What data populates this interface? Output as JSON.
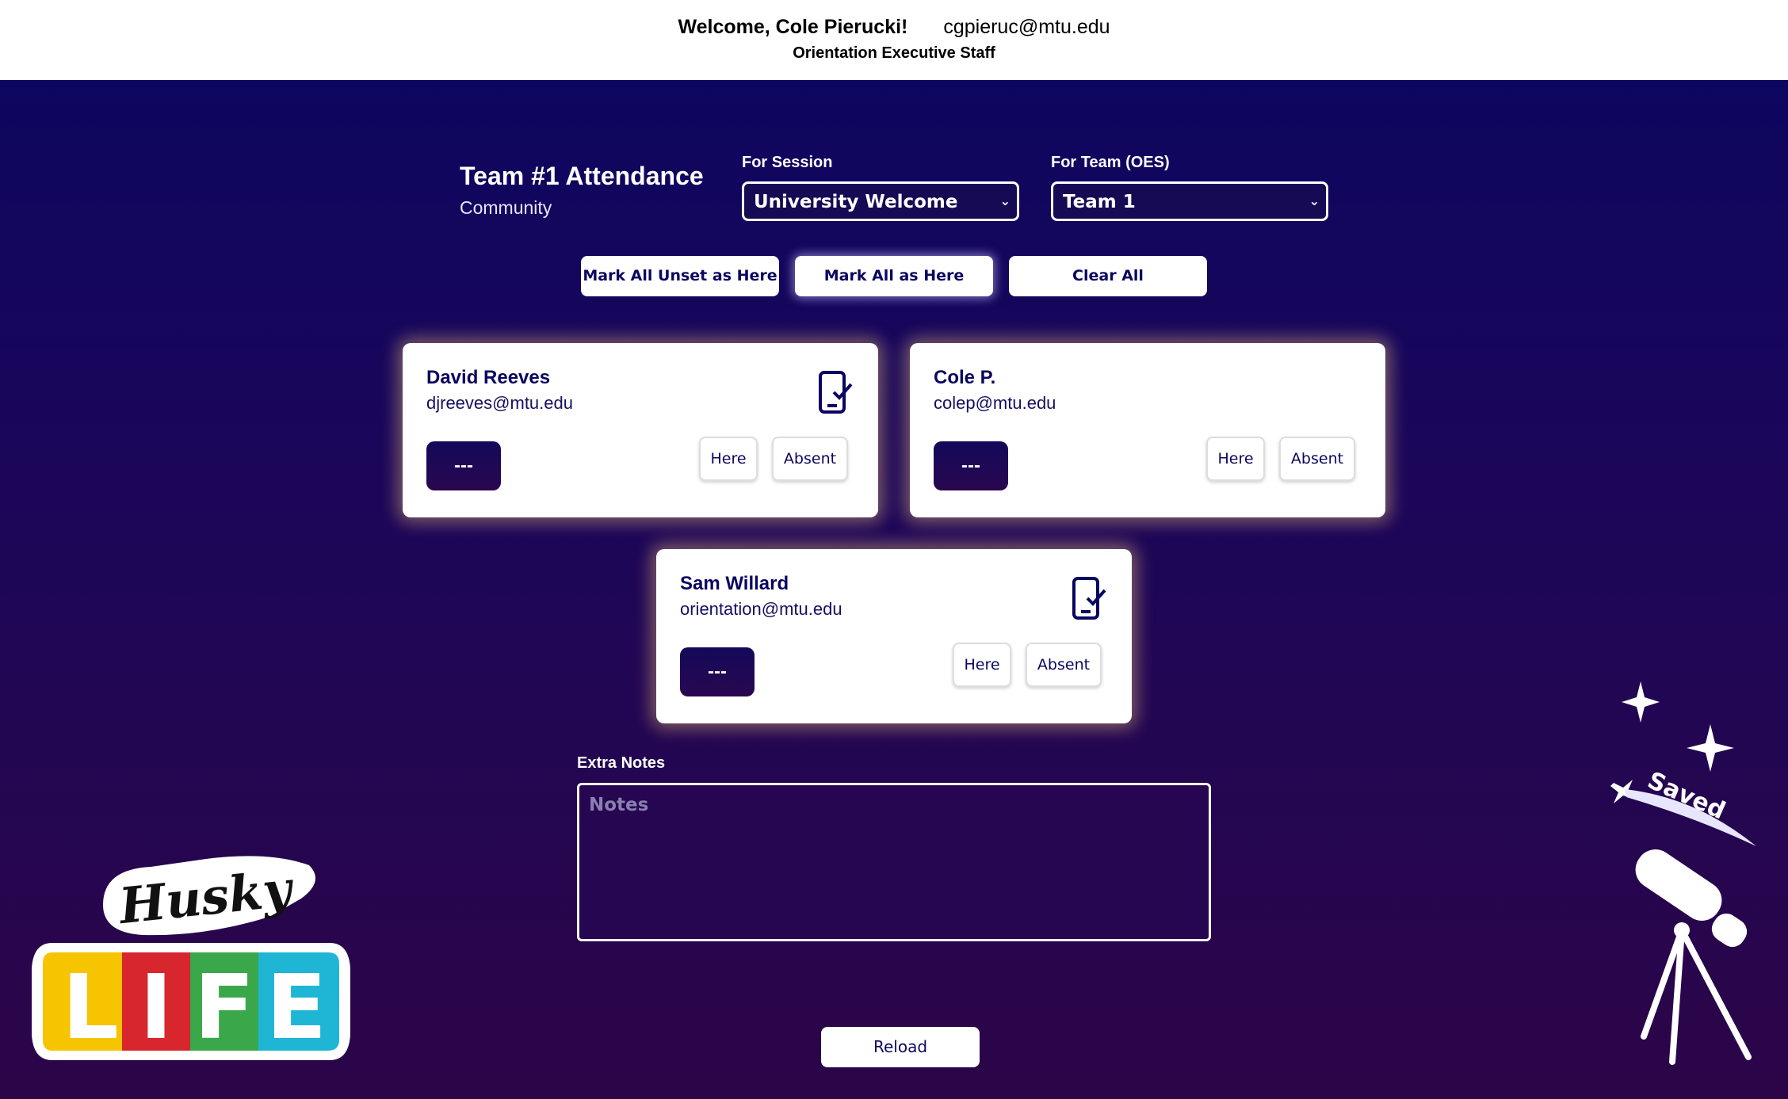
{
  "header": {
    "welcome": "Welcome, Cole Pierucki!",
    "email": "cgpieruc@mtu.edu",
    "role": "Orientation Executive Staff"
  },
  "page": {
    "title": "Team #1 Attendance",
    "subtitle": "Community"
  },
  "filters": {
    "session_label": "For Session",
    "session_value": "University Welcome",
    "team_label": "For Team (OES)",
    "team_value": "Team 1"
  },
  "actions": {
    "mark_unset": "Mark All Unset as Here",
    "mark_all": "Mark All as Here",
    "clear_all": "Clear All"
  },
  "members": [
    {
      "name": "David Reeves",
      "email": "djreeves@mtu.edu",
      "status": "---",
      "here": "Here",
      "absent": "Absent",
      "icon": "mobile-check-icon"
    },
    {
      "name": "Cole P.",
      "email": "colep@mtu.edu",
      "status": "---",
      "here": "Here",
      "absent": "Absent"
    },
    {
      "name": "Sam Willard",
      "email": "orientation@mtu.edu",
      "status": "---",
      "here": "Here",
      "absent": "Absent",
      "icon": "mobile-check-icon"
    }
  ],
  "notes": {
    "label": "Extra Notes",
    "placeholder": "Notes"
  },
  "reload_label": "Reload",
  "logo": {
    "word1": "Husky",
    "word2": "LIFE"
  },
  "saved_badge": "Saved",
  "colors": {
    "navy": "#0a0660",
    "gold_glow": "#ffcd78",
    "life_yellow": "#f6c400",
    "life_red": "#d8262f",
    "life_green": "#3aa84a",
    "life_cyan": "#1fb6d6"
  }
}
